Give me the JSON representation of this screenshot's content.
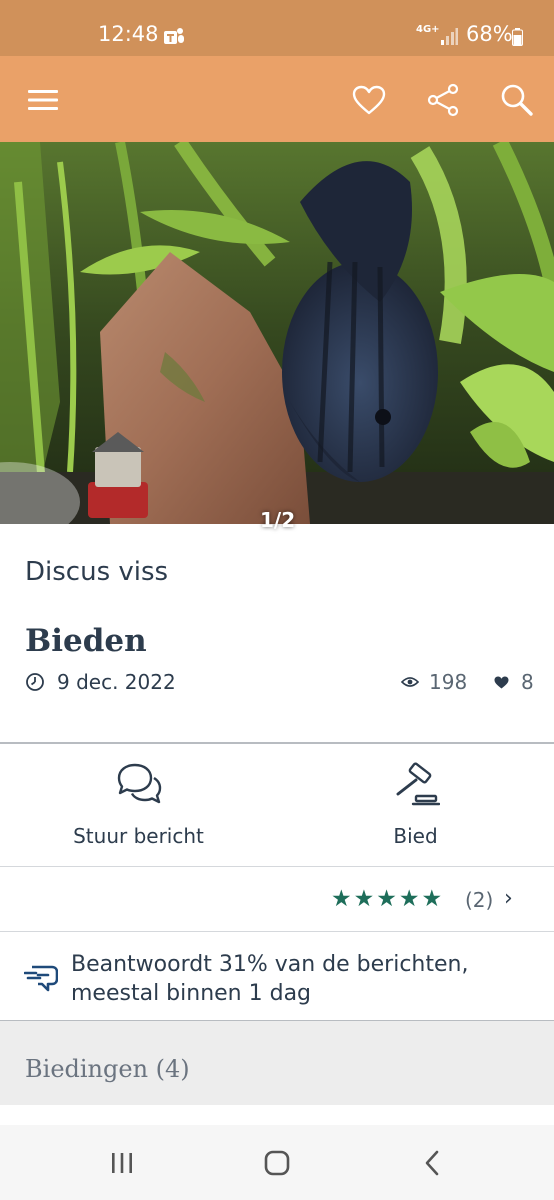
{
  "status_bar": {
    "time": "12:48",
    "network": "4G+",
    "battery": "68%"
  },
  "app_bar": {
    "menu_icon": "hamburger-menu-icon",
    "favorite_icon": "heart-outline-icon",
    "share_icon": "share-icon",
    "search_icon": "search-icon",
    "background_color": "#eaa168"
  },
  "photo": {
    "counter": "1/2"
  },
  "listing": {
    "title": "Discus viss",
    "price": "Bieden",
    "date": "9 dec. 2022",
    "views": "198",
    "favorites": "8"
  },
  "actions": {
    "message_label": "Stuur bericht",
    "bid_label": "Bied"
  },
  "rating": {
    "stars": 5,
    "count": "(2)",
    "star_color": "#1e6e5a"
  },
  "seller_response": {
    "text": "Beantwoordt 31% van de berichten, meestal binnen 1 dag"
  },
  "bids": {
    "title": "Biedingen (4)"
  }
}
